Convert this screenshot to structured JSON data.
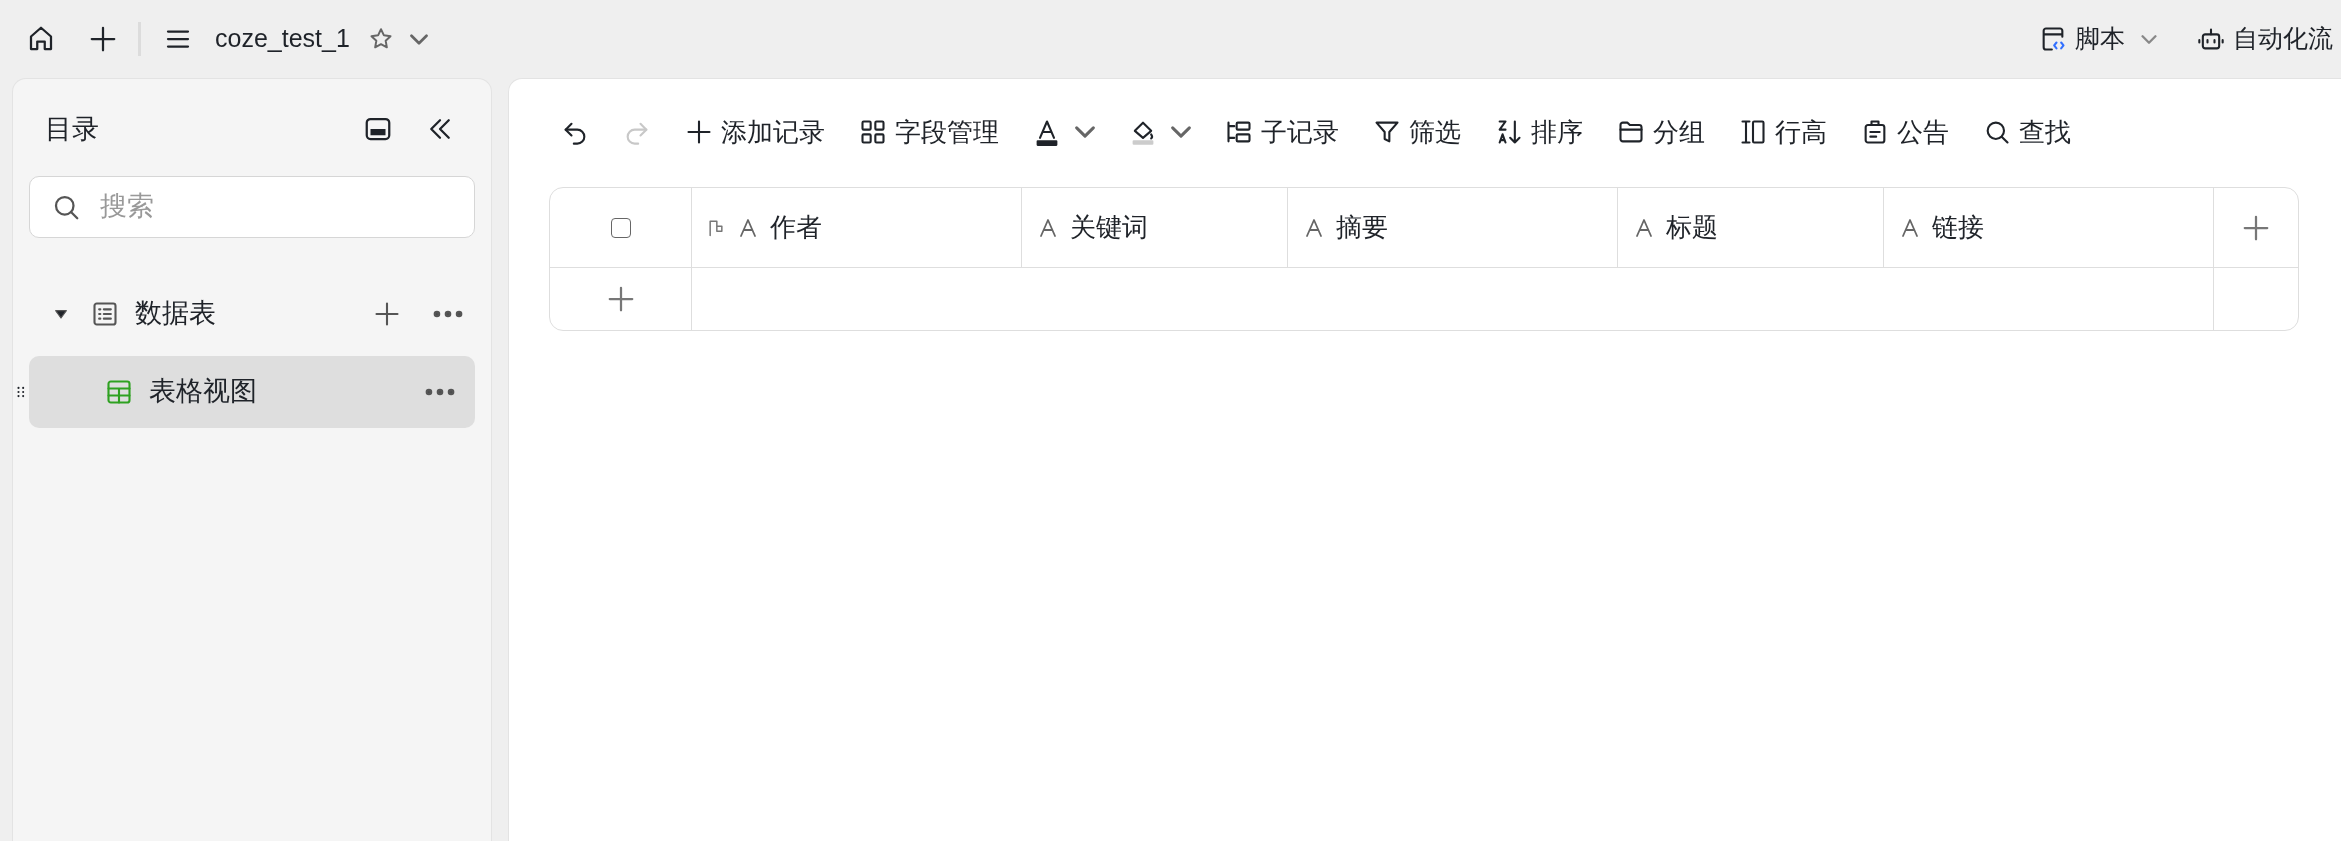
{
  "topbar": {
    "title": "coze_test_1",
    "starred": false,
    "right_items": [
      {
        "kind": "script",
        "label": "脚本",
        "dropdown": true
      },
      {
        "kind": "robot",
        "label": "自动化流",
        "dropdown": false
      }
    ]
  },
  "sidebar": {
    "title": "目录",
    "search": {
      "placeholder": "搜索"
    },
    "tree": [
      {
        "label": "数据表",
        "kind": "list",
        "expanded": true,
        "selected": false,
        "children": [
          {
            "label": "表格视图",
            "kind": "grid",
            "selected": true
          }
        ]
      }
    ]
  },
  "toolbar": [
    {
      "kind": "undo",
      "disabled": false
    },
    {
      "kind": "redo",
      "disabled": true
    },
    {
      "kind": "add",
      "label": "添加记录",
      "disabled": false
    },
    {
      "kind": "fields",
      "label": "字段管理",
      "disabled": false
    },
    {
      "kind": "text-color",
      "disabled": false
    },
    {
      "kind": "fill-color",
      "disabled": false
    },
    {
      "kind": "subrecord",
      "label": "子记录",
      "disabled": false
    },
    {
      "kind": "filter",
      "label": "筛选",
      "disabled": false
    },
    {
      "kind": "sort",
      "label": "排序",
      "disabled": false
    },
    {
      "kind": "group",
      "label": "分组",
      "disabled": false
    },
    {
      "kind": "row-height",
      "label": "行高",
      "disabled": false
    },
    {
      "kind": "notice",
      "label": "公告",
      "disabled": false
    },
    {
      "kind": "search",
      "label": "查找",
      "disabled": false
    }
  ],
  "table": {
    "all_checked": false,
    "columns": [
      {
        "label": "作者",
        "primary": true
      },
      {
        "label": "关键词",
        "primary": false
      },
      {
        "label": "摘要",
        "primary": false
      },
      {
        "label": "标题",
        "primary": false
      },
      {
        "label": "链接",
        "primary": false
      }
    ]
  }
}
